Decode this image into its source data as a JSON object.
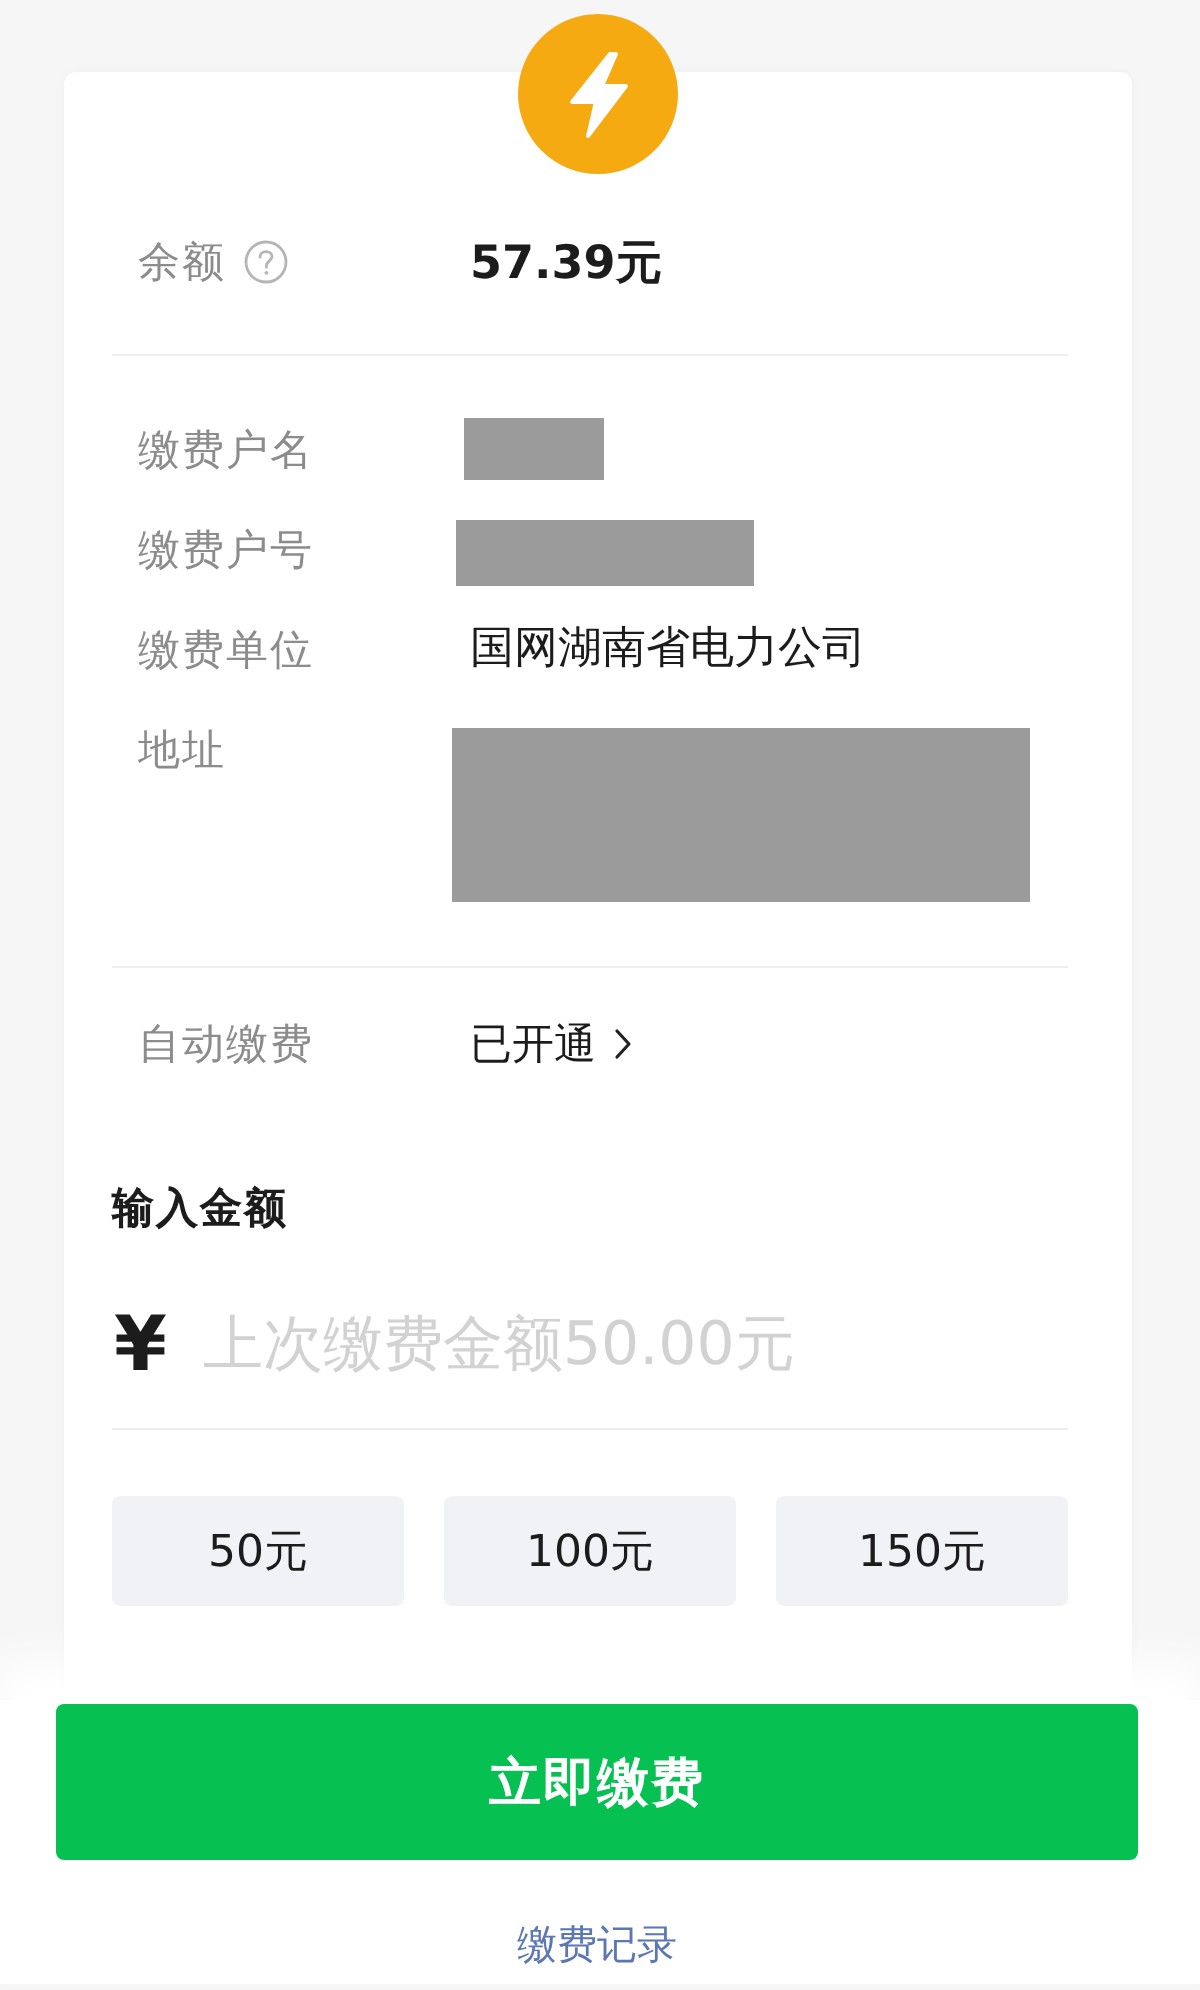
{
  "balance": {
    "label": "余额",
    "value": "57.39元"
  },
  "account_info": [
    {
      "label": "缴费户名",
      "redacted": true
    },
    {
      "label": "缴费户号",
      "redacted": true
    },
    {
      "label": "缴费单位",
      "redacted": false,
      "value": "国网湖南省电力公司"
    },
    {
      "label": "地址",
      "redacted": true
    }
  ],
  "auto_pay": {
    "label": "自动缴费",
    "value": "已开通"
  },
  "amount": {
    "label": "输入金额",
    "currency_symbol": "¥",
    "placeholder": "上次缴费金额50.00元"
  },
  "preset_amounts": [
    {
      "label": "50元",
      "selected": false
    },
    {
      "label": "100元",
      "selected": false
    },
    {
      "label": "150元",
      "selected": false
    }
  ],
  "pay_button": "立即缴费",
  "history_link": "缴费记录"
}
